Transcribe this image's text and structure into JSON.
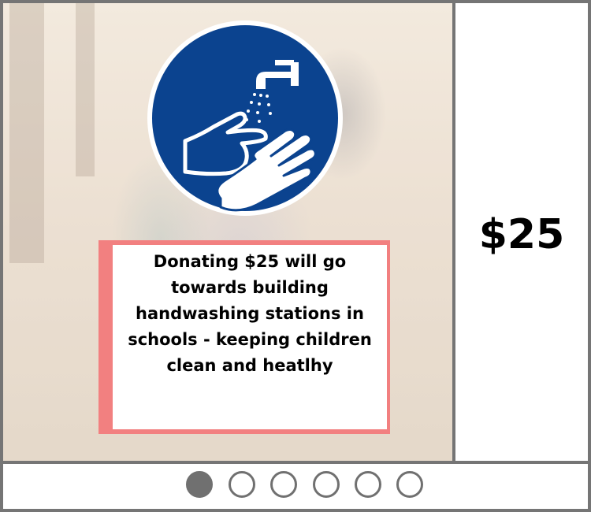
{
  "slide": {
    "icon": "handwashing-sign-icon",
    "description": "Donating $25 will go towards building handwashing stations in schools - keeping children clean and heatlhy"
  },
  "amount": "$25",
  "pagination": {
    "active_index": 0,
    "count": 6
  },
  "colors": {
    "sign_blue": "#0b438f",
    "card_border": "#f28080",
    "frame": "#757575"
  }
}
